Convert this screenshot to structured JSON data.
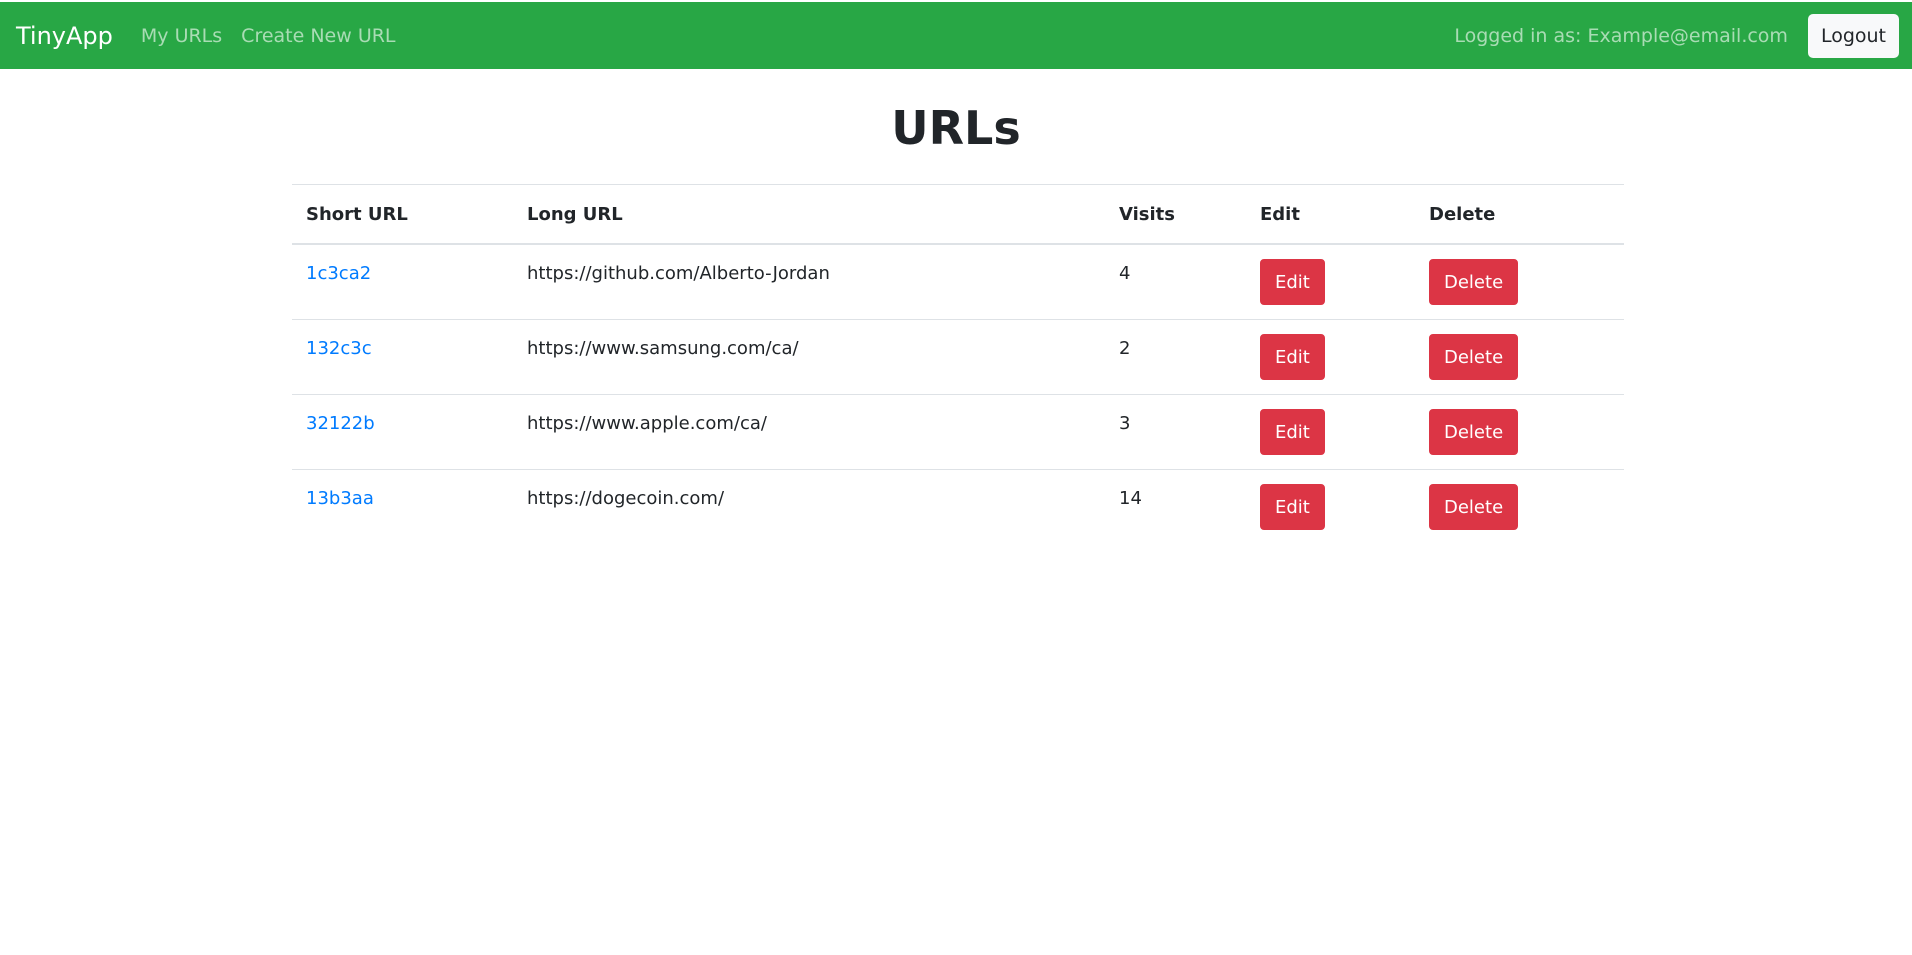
{
  "navbar": {
    "brand": "TinyApp",
    "links": [
      "My URLs",
      "Create New URL"
    ],
    "login_status": "Logged in as: Example@email.com",
    "logout_label": "Logout",
    "color": "#28a745"
  },
  "page": {
    "title": "URLs"
  },
  "table": {
    "headers": [
      "Short URL",
      "Long URL",
      "Visits",
      "Edit",
      "Delete"
    ],
    "rows": [
      {
        "short": "1c3ca2",
        "long": "https://github.com/Alberto-Jordan",
        "visits": "4",
        "edit": "Edit",
        "delete": "Delete"
      },
      {
        "short": "132c3c",
        "long": "https://www.samsung.com/ca/",
        "visits": "2",
        "edit": "Edit",
        "delete": "Delete"
      },
      {
        "short": "32122b",
        "long": "https://www.apple.com/ca/",
        "visits": "3",
        "edit": "Edit",
        "delete": "Delete"
      },
      {
        "short": "13b3aa",
        "long": "https://dogecoin.com/",
        "visits": "14",
        "edit": "Edit",
        "delete": "Delete"
      }
    ]
  },
  "colors": {
    "link": "#007bff",
    "danger": "#dc3545"
  }
}
